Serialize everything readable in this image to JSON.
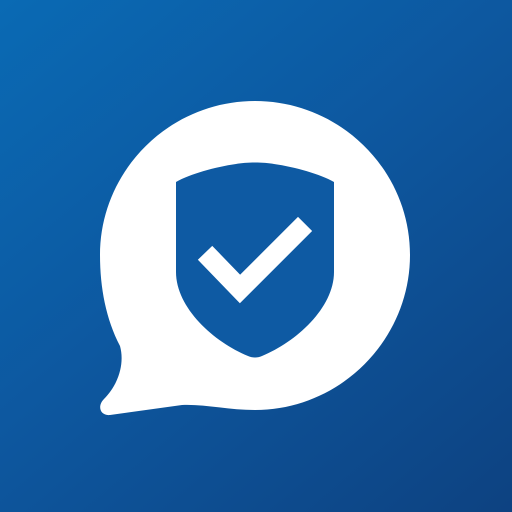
{
  "app_icon": {
    "icon_names": [
      "chat-bubble-icon",
      "shield-icon",
      "checkmark-icon"
    ],
    "colors": {
      "background_start": "#0a6ab4",
      "background_mid": "#0d58a0",
      "background_end": "#0d4281",
      "bubble": "#ffffff",
      "shield": "#0e5aa3",
      "checkmark": "#ffffff"
    }
  }
}
